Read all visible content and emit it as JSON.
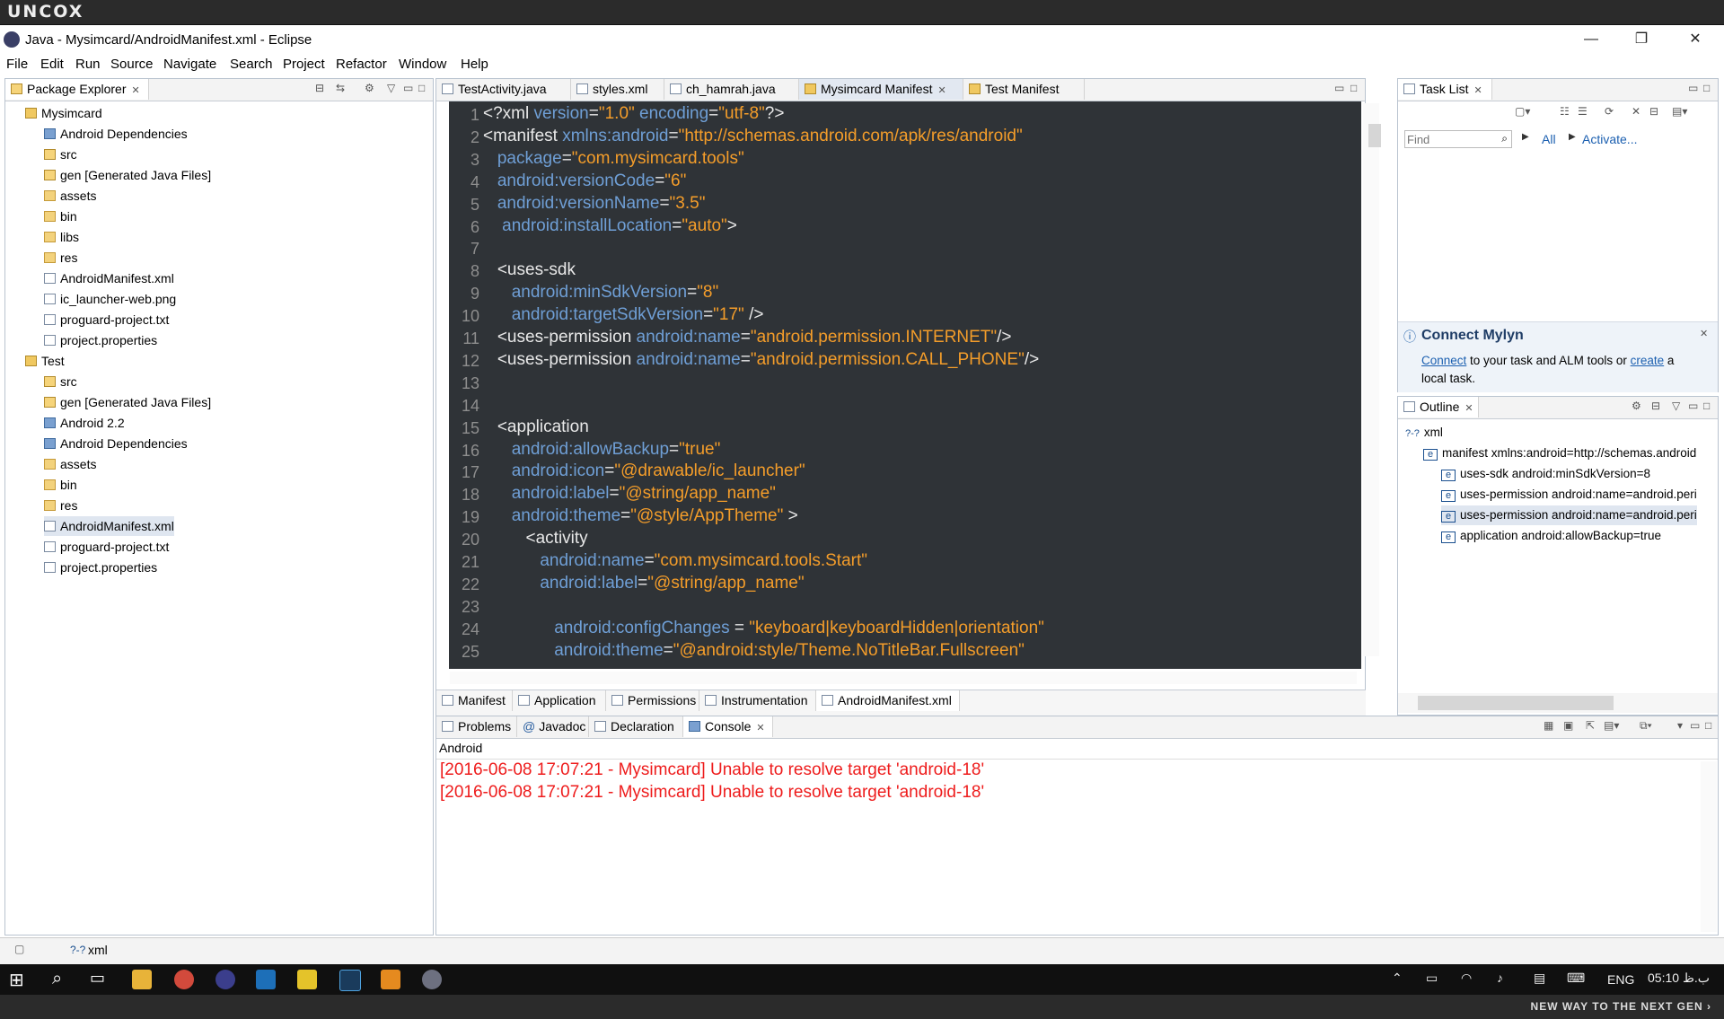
{
  "brand": {
    "logo": "UNCOX",
    "slogan": "NEW WAY TO THE NEXT GEN ›"
  },
  "window": {
    "title": "Java - Mysimcard/AndroidManifest.xml - Eclipse",
    "minimize": "—",
    "maximize": "❐",
    "close": "✕"
  },
  "menu": [
    "File",
    "Edit",
    "Run",
    "Source",
    "Navigate",
    "Search",
    "Project",
    "Refactor",
    "Window",
    "Help"
  ],
  "package_explorer": {
    "title": "Package Explorer",
    "items": [
      {
        "label": "Mysimcard",
        "icon": "project"
      },
      {
        "label": "Android Dependencies",
        "icon": "library"
      },
      {
        "label": "src",
        "icon": "package"
      },
      {
        "label": "gen [Generated Java Files]",
        "icon": "package"
      },
      {
        "label": "assets",
        "icon": "folder"
      },
      {
        "label": "bin",
        "icon": "folder"
      },
      {
        "label": "libs",
        "icon": "folder"
      },
      {
        "label": "res",
        "icon": "folder"
      },
      {
        "label": "AndroidManifest.xml",
        "icon": "file"
      },
      {
        "label": "ic_launcher-web.png",
        "icon": "file"
      },
      {
        "label": "proguard-project.txt",
        "icon": "file"
      },
      {
        "label": "project.properties",
        "icon": "file"
      },
      {
        "label": "Test",
        "icon": "project"
      },
      {
        "label": "src",
        "icon": "package"
      },
      {
        "label": "gen [Generated Java Files]",
        "icon": "package"
      },
      {
        "label": "Android 2.2",
        "icon": "library"
      },
      {
        "label": "Android Dependencies",
        "icon": "library"
      },
      {
        "label": "assets",
        "icon": "folder"
      },
      {
        "label": "bin",
        "icon": "folder"
      },
      {
        "label": "res",
        "icon": "folder"
      },
      {
        "label": "AndroidManifest.xml",
        "icon": "file"
      },
      {
        "label": "proguard-project.txt",
        "icon": "file"
      },
      {
        "label": "project.properties",
        "icon": "file"
      }
    ]
  },
  "editor_tabs": [
    {
      "label": "TestActivity.java"
    },
    {
      "label": "styles.xml"
    },
    {
      "label": "ch_hamrah.java"
    },
    {
      "label": "Mysimcard Manifest"
    },
    {
      "label": "Test Manifest"
    }
  ],
  "code_lines": [
    {
      "n": "1",
      "t": [
        [
          "pu",
          "<?"
        ],
        [
          "kw",
          "xml "
        ],
        [
          "at",
          "version"
        ],
        [
          "pu",
          "="
        ],
        [
          "st",
          "\"1.0\""
        ],
        [
          "kw",
          " "
        ],
        [
          "at",
          "encoding"
        ],
        [
          "pu",
          "="
        ],
        [
          "st",
          "\"utf-8\""
        ],
        [
          "pu",
          "?>"
        ]
      ]
    },
    {
      "n": "2",
      "t": [
        [
          "pu",
          "<"
        ],
        [
          "kw",
          "manifest "
        ],
        [
          "at",
          "xmlns:android"
        ],
        [
          "pu",
          "="
        ],
        [
          "st",
          "\"http://schemas.android.com/apk/res/android\""
        ]
      ]
    },
    {
      "n": "3",
      "t": [
        [
          "kw",
          "   "
        ],
        [
          "at",
          "package"
        ],
        [
          "pu",
          "="
        ],
        [
          "st",
          "\"com.mysimcard.tools\""
        ]
      ]
    },
    {
      "n": "4",
      "t": [
        [
          "kw",
          "   "
        ],
        [
          "at",
          "android:versionCode"
        ],
        [
          "pu",
          "="
        ],
        [
          "st",
          "\"6\""
        ]
      ]
    },
    {
      "n": "5",
      "t": [
        [
          "kw",
          "   "
        ],
        [
          "at",
          "android:versionName"
        ],
        [
          "pu",
          "="
        ],
        [
          "st",
          "\"3.5\""
        ]
      ]
    },
    {
      "n": "6",
      "t": [
        [
          "kw",
          "    "
        ],
        [
          "at",
          "android:installLocation"
        ],
        [
          "pu",
          "="
        ],
        [
          "st",
          "\"auto\""
        ],
        [
          "pu",
          ">"
        ]
      ]
    },
    {
      "n": "7",
      "t": []
    },
    {
      "n": "8",
      "t": [
        [
          "kw",
          "   <uses-sdk"
        ]
      ]
    },
    {
      "n": "9",
      "t": [
        [
          "kw",
          "      "
        ],
        [
          "at",
          "android:minSdkVersion"
        ],
        [
          "pu",
          "="
        ],
        [
          "st",
          "\"8\""
        ]
      ]
    },
    {
      "n": "10",
      "t": [
        [
          "kw",
          "      "
        ],
        [
          "at",
          "android:targetSdkVersion"
        ],
        [
          "pu",
          "="
        ],
        [
          "st",
          "\"17\""
        ],
        [
          "pu",
          " />"
        ]
      ]
    },
    {
      "n": "11",
      "t": [
        [
          "kw",
          "   <uses-permission "
        ],
        [
          "at",
          "android:name"
        ],
        [
          "pu",
          "="
        ],
        [
          "st",
          "\"android.permission.INTERNET\""
        ],
        [
          "pu",
          "/>"
        ]
      ]
    },
    {
      "n": "12",
      "t": [
        [
          "kw",
          "   <uses-permission "
        ],
        [
          "at",
          "android:name"
        ],
        [
          "pu",
          "="
        ],
        [
          "st",
          "\"android.permission.CALL_PHONE\""
        ],
        [
          "pu",
          "/>"
        ]
      ]
    },
    {
      "n": "13",
      "t": []
    },
    {
      "n": "14",
      "t": []
    },
    {
      "n": "15",
      "t": [
        [
          "kw",
          "   <application"
        ]
      ]
    },
    {
      "n": "16",
      "t": [
        [
          "kw",
          "      "
        ],
        [
          "at",
          "android:allowBackup"
        ],
        [
          "pu",
          "="
        ],
        [
          "st",
          "\"true\""
        ]
      ]
    },
    {
      "n": "17",
      "t": [
        [
          "kw",
          "      "
        ],
        [
          "at",
          "android:icon"
        ],
        [
          "pu",
          "="
        ],
        [
          "st",
          "\"@drawable/ic_launcher\""
        ]
      ]
    },
    {
      "n": "18",
      "t": [
        [
          "kw",
          "      "
        ],
        [
          "at",
          "android:label"
        ],
        [
          "pu",
          "="
        ],
        [
          "st",
          "\"@string/app_name\""
        ]
      ]
    },
    {
      "n": "19",
      "t": [
        [
          "kw",
          "      "
        ],
        [
          "at",
          "android:theme"
        ],
        [
          "pu",
          "="
        ],
        [
          "st",
          "\"@style/AppTheme\""
        ],
        [
          "pu",
          " >"
        ]
      ]
    },
    {
      "n": "20",
      "t": [
        [
          "kw",
          "         <activity"
        ]
      ]
    },
    {
      "n": "21",
      "t": [
        [
          "kw",
          "            "
        ],
        [
          "at",
          "android:name"
        ],
        [
          "pu",
          "="
        ],
        [
          "st",
          "\"com.mysimcard.tools.Start\""
        ]
      ]
    },
    {
      "n": "22",
      "t": [
        [
          "kw",
          "            "
        ],
        [
          "at",
          "android:label"
        ],
        [
          "pu",
          "="
        ],
        [
          "st",
          "\"@string/app_name\""
        ]
      ]
    },
    {
      "n": "23",
      "t": []
    },
    {
      "n": "24",
      "t": [
        [
          "kw",
          "               "
        ],
        [
          "at",
          "android:configChanges"
        ],
        [
          "pu",
          " = "
        ],
        [
          "st",
          "\"keyboard|keyboardHidden|orientation\""
        ]
      ]
    },
    {
      "n": "25",
      "t": [
        [
          "kw",
          "               "
        ],
        [
          "at",
          "android:theme"
        ],
        [
          "pu",
          "="
        ],
        [
          "st",
          "\"@android:style/Theme.NoTitleBar.Fullscreen\""
        ]
      ]
    }
  ],
  "editor_bottom_tabs": [
    {
      "label": "Manifest"
    },
    {
      "label": "Application"
    },
    {
      "label": "Permissions"
    },
    {
      "label": "Instrumentation"
    },
    {
      "label": "AndroidManifest.xml"
    }
  ],
  "task_list": {
    "title": "Task List",
    "find_placeholder": "Find",
    "all": "All",
    "activate": "Activate..."
  },
  "mylyn": {
    "title": "Connect Mylyn",
    "connect": "Connect",
    "text1": " to your task and ALM tools or ",
    "create": "create",
    "text2": " a",
    "text3": "local task."
  },
  "outline": {
    "title": "Outline",
    "items": [
      {
        "label": "xml",
        "indent": 0
      },
      {
        "label": "manifest xmlns:android=http://schemas.android",
        "indent": 1
      },
      {
        "label": "uses-sdk android:minSdkVersion=8",
        "indent": 2
      },
      {
        "label": "uses-permission android:name=android.peri",
        "indent": 2
      },
      {
        "label": "uses-permission android:name=android.peri",
        "indent": 2
      },
      {
        "label": "application android:allowBackup=true",
        "indent": 2
      }
    ]
  },
  "bottom_tabs": [
    {
      "label": "Problems"
    },
    {
      "label": "Javadoc"
    },
    {
      "label": "Declaration"
    },
    {
      "label": "Console"
    }
  ],
  "console": {
    "title": "Android",
    "lines": [
      "[2016-06-08 17:07:21 - Mysimcard] Unable to resolve target 'android-18'",
      "[2016-06-08 17:07:21 - Mysimcard] Unable to resolve target 'android-18'"
    ]
  },
  "status": {
    "text": "xml"
  },
  "taskbar": {
    "lang": "ENG",
    "time": "05:10 ب.ظ"
  }
}
